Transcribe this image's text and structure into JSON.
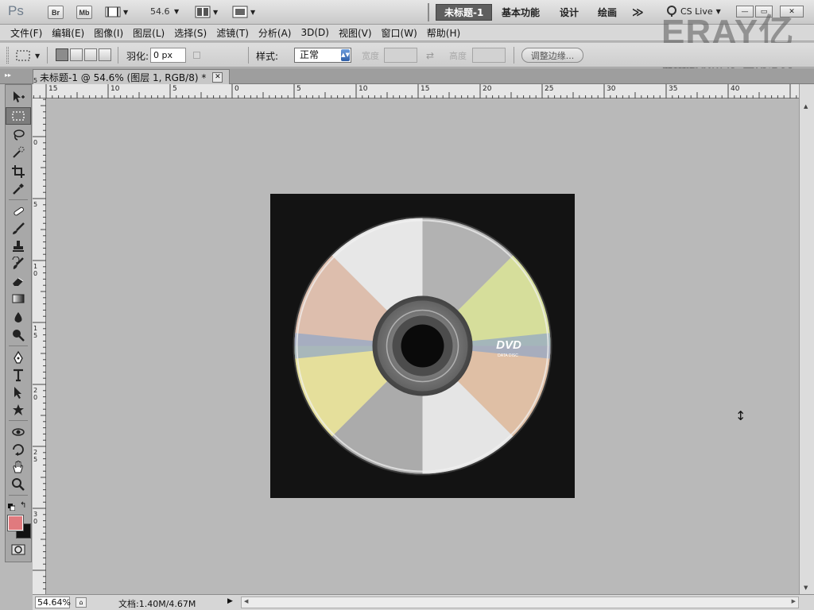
{
  "app": {
    "logo": "Ps",
    "bridge_label": "Br",
    "minibridge_label": "Mb",
    "zoom_value": "54.6"
  },
  "workspace": {
    "tabs": [
      "未标题-1",
      "基本功能",
      "设计",
      "绘画"
    ],
    "more": "≫",
    "cslive": "CS Live"
  },
  "window_buttons": {
    "minimize": "—",
    "restore": "▭",
    "close": "✕"
  },
  "watermark": {
    "brand": "ERAY亿瑞",
    "sub": "DESIGN STUDIO",
    "line": "视频版权所有 盗用必究"
  },
  "menu": [
    "文件(F)",
    "编辑(E)",
    "图像(I)",
    "图层(L)",
    "选择(S)",
    "滤镜(T)",
    "分析(A)",
    "3D(D)",
    "视图(V)",
    "窗口(W)",
    "帮助(H)"
  ],
  "options": {
    "feather_label": "羽化:",
    "feather_value": "0 px",
    "style_label": "样式:",
    "style_value": "正常",
    "width_label": "宽度",
    "height_label": "高度",
    "refine_label": "调整边缘..."
  },
  "document_tab": {
    "title": "未标题-1 @ 54.6% (图层 1, RGB/8) *",
    "close": "✕"
  },
  "hruler_labels": [
    "15",
    "10",
    "5",
    "0",
    "5",
    "10",
    "15",
    "20",
    "25",
    "30",
    "35",
    "40"
  ],
  "vruler_labels": [
    "5",
    "0",
    "5",
    "1 0",
    "1 5",
    "2 0",
    "2 5",
    "3 0"
  ],
  "disc": {
    "logo_text": "DVD",
    "logo_sub": "DATA DISC"
  },
  "colors": {
    "foreground": "#e07a7e",
    "background": "#111111",
    "canvas_bg": "#131313",
    "workspace_bg": "#b9b9b9"
  },
  "status": {
    "zoom": "54.64%",
    "doc_info": "文档:1.40M/4.67M"
  },
  "tools": [
    "move-tool",
    "marquee-tool",
    "lasso-tool",
    "quick-select-tool",
    "crop-tool",
    "eyedropper-tool",
    "healing-brush-tool",
    "brush-tool",
    "clone-stamp-tool",
    "history-brush-tool",
    "eraser-tool",
    "gradient-tool",
    "blur-tool",
    "dodge-tool",
    "pen-tool",
    "type-tool",
    "path-select-tool",
    "shape-tool",
    "3d-rotate-tool",
    "3d-orbit-tool",
    "hand-tool",
    "zoom-tool"
  ]
}
